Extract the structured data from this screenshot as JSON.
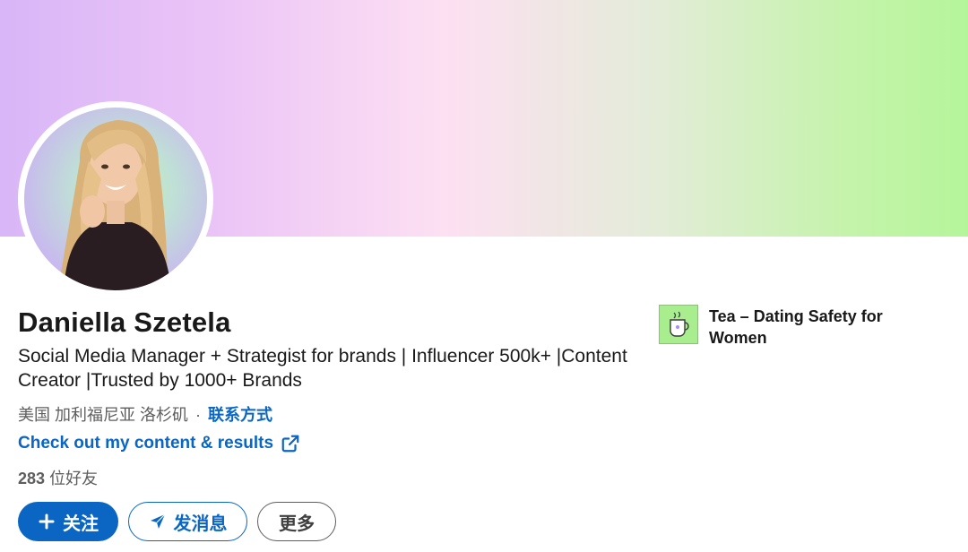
{
  "profile": {
    "name": "Daniella Szetela",
    "headline": "Social Media Manager + Strategist for brands | Influencer 500k+ |Content Creator |Trusted by 1000+ Brands",
    "location": "美国 加利福尼亚 洛杉矶",
    "separator": "·",
    "contact_label": "联系方式",
    "website_label": "Check out my content & results",
    "connections_count": "283",
    "connections_suffix": " 位好友"
  },
  "actions": {
    "follow_label": "关注",
    "message_label": "发消息",
    "more_label": "更多"
  },
  "company": {
    "name": "Tea – Dating Safety for Women",
    "logo_icon": "tea-cup-icon"
  },
  "colors": {
    "accent": "#0a66c2",
    "logo_bg": "#a8ee8e"
  }
}
